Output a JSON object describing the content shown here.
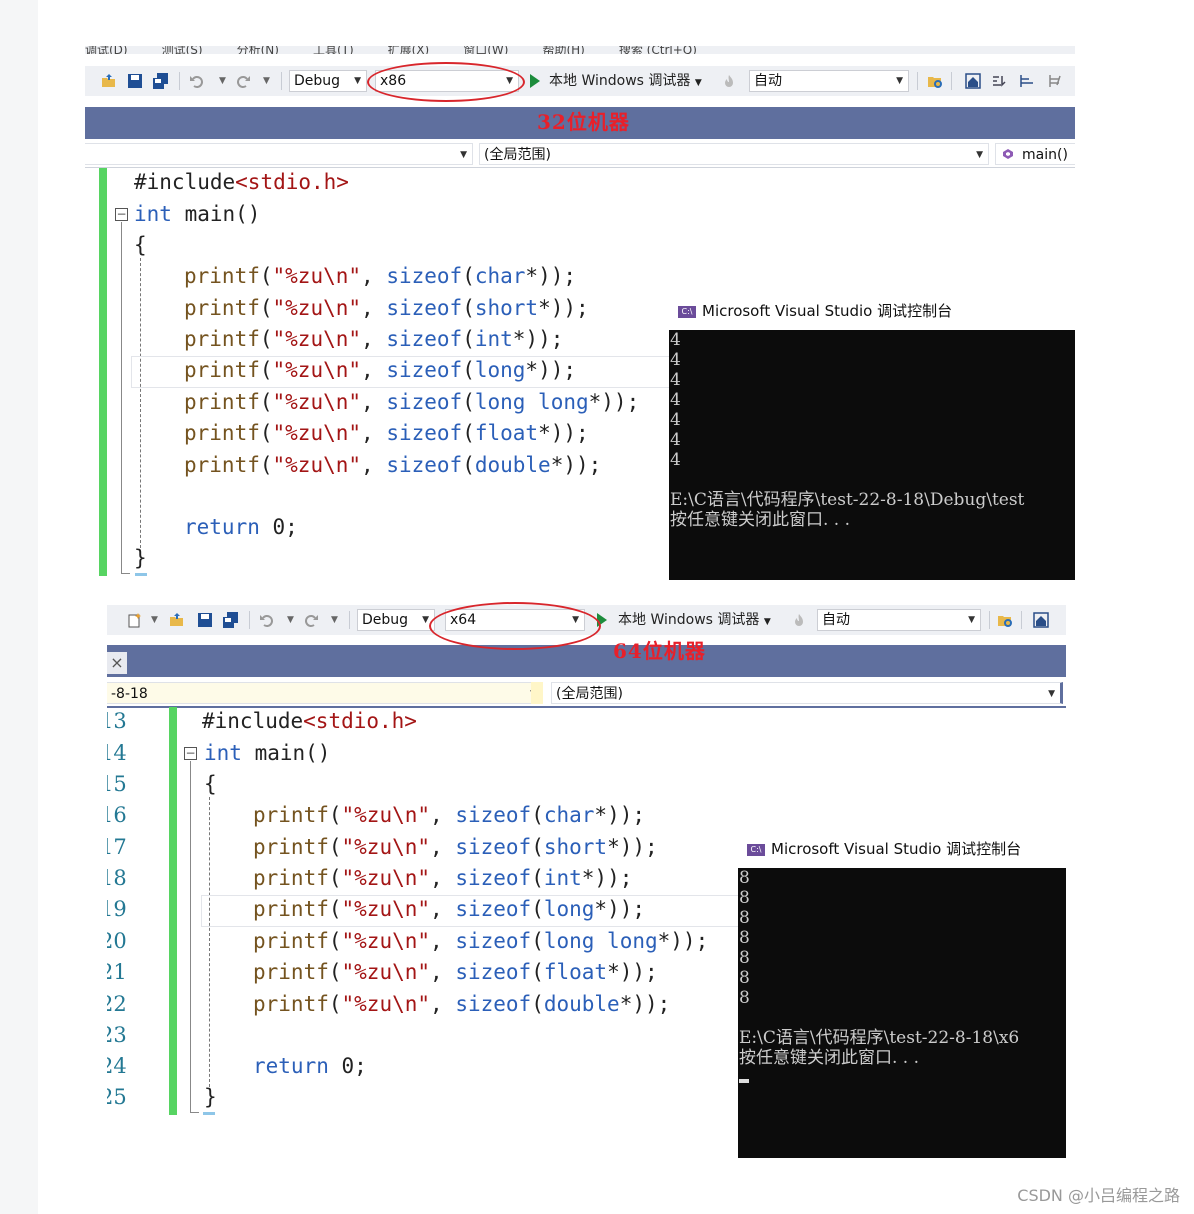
{
  "top": {
    "menu": [
      "调试(D)",
      "测试(S)",
      "分析(N)",
      "工具(T)",
      "扩展(X)",
      "窗口(W)",
      "帮助(H)",
      "搜索 (Ctrl+Q)"
    ],
    "config": "Debug",
    "platform": "x86",
    "run_label": "本地 Windows 调试器",
    "auto": "自动",
    "annotation": "32位机器",
    "nav_scope": "(全局范围)",
    "nav_member": "main()",
    "console_title": "Microsoft Visual Studio 调试控制台",
    "console_lines": [
      "4",
      "4",
      "4",
      "4",
      "4",
      "4",
      "4",
      "",
      "E:\\C语言\\代码程序\\test-22-8-18\\Debug\\test",
      "按任意键关闭此窗口. . ."
    ]
  },
  "bottom": {
    "config": "Debug",
    "platform": "x64",
    "run_label": "本地 Windows 调试器",
    "auto": "自动",
    "annotation": "64位机器",
    "nav_left": "-8-18",
    "nav_scope": "(全局范围)",
    "close": "×",
    "line_numbers": [
      "13",
      "14",
      "15",
      "16",
      "17",
      "18",
      "19",
      "20",
      "21",
      "22",
      "23",
      "24",
      "25"
    ],
    "console_title": "Microsoft Visual Studio 调试控制台",
    "console_lines": [
      "8",
      "8",
      "8",
      "8",
      "8",
      "8",
      "8",
      "",
      "E:\\C语言\\代码程序\\test-22-8-18\\x6",
      "按任意键关闭此窗口. . ."
    ]
  },
  "code": {
    "include": "#include",
    "header": "<stdio.h>",
    "int_kw": "int",
    "main_sig": " main()",
    "open_brace": "{",
    "close_brace": "}",
    "printf": "printf",
    "fmt": "\"%zu\\n\"",
    "sizeof": "sizeof",
    "types": [
      "char",
      "short",
      "int",
      "long",
      "long long",
      "float",
      "double"
    ],
    "return_kw": "return",
    "ret_val": " 0;"
  },
  "watermark": "CSDN @小吕编程之路",
  "colors": {
    "keyword": "#2b5fb8",
    "function": "#74531f",
    "string": "#a31515",
    "annotation": "#e8202a",
    "gutter": "#57d462"
  }
}
